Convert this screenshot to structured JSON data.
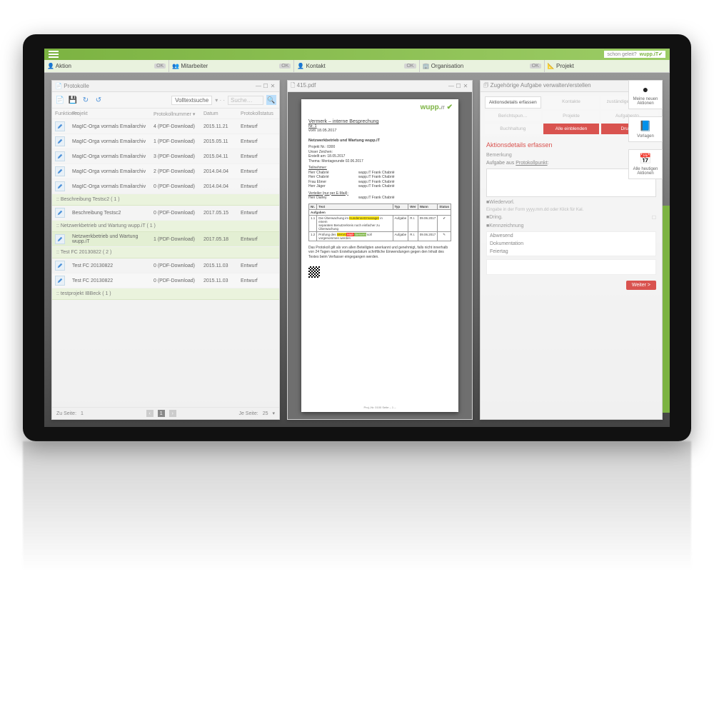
{
  "brand": {
    "tagline": "schon geleit?",
    "name": "wupp.",
    "suffix": "iT"
  },
  "tabs": [
    {
      "icon": "👤",
      "label": "Aktion",
      "ok": "OK"
    },
    {
      "icon": "👥",
      "label": "Mitarbeiter",
      "ok": "OK"
    },
    {
      "icon": "👤",
      "label": "Kontakt",
      "ok": "OK"
    },
    {
      "icon": "🏢",
      "label": "Organisation",
      "ok": "OK"
    },
    {
      "icon": "📐",
      "label": "Projekt",
      "ok": ""
    }
  ],
  "leftPanel": {
    "title": "Protokolle",
    "filterSelect": "Volltextsuche",
    "searchPlaceholder": "Suche…",
    "columns": {
      "c1": "Funktionen",
      "c2": "Projekt",
      "c3": "Protokollnummer",
      "c4": "Datum",
      "c5": "Protokollstatus"
    },
    "groups": [
      {
        "label": ":: MagIC-Orga vormals Emailarchiv",
        "rows": [
          {
            "project": "MagIC-Orga vormals Emailarchiv",
            "num": "4 (PDF-Download)",
            "date": "2015.11.21",
            "status": "Entwurf"
          },
          {
            "project": "MagIC-Orga vormals Emailarchiv",
            "num": "1 (PDF-Download)",
            "date": "2015.05.11",
            "status": "Entwurf"
          },
          {
            "project": "MagIC-Orga vormals Emailarchiv",
            "num": "3 (PDF-Download)",
            "date": "2015.04.11",
            "status": "Entwurf"
          },
          {
            "project": "MagIC-Orga vormals Emailarchiv",
            "num": "2 (PDF-Download)",
            "date": "2014.04.04",
            "status": "Entwurf"
          },
          {
            "project": "MagIC-Orga vormals Emailarchiv",
            "num": "0 (PDF-Download)",
            "date": "2014.04.04",
            "status": "Entwurf"
          }
        ]
      },
      {
        "label": ":: Beschreibung Testsc2 ( 1 )",
        "rows": [
          {
            "project": "Beschreibung Testsc2",
            "num": "0 (PDF-Download)",
            "date": "2017.05.15",
            "status": "Entwurf"
          }
        ]
      },
      {
        "label": ":: Netzwerkbetrieb und Wartung wupp.iT ( 1 )",
        "rows": [
          {
            "project": "Netzwerkbetrieb und Wartung wupp.iT",
            "num": "1 (PDF-Download)",
            "date": "2017.05.18",
            "status": "Entwurf",
            "selected": true
          }
        ]
      },
      {
        "label": ":: Test FC 20130822 ( 2 )",
        "rows": [
          {
            "project": "Test FC 20130822",
            "num": "0 (PDF-Download)",
            "date": "2015.11.03",
            "status": "Entwurf"
          },
          {
            "project": "Test FC 20130822",
            "num": "0 (PDF-Download)",
            "date": "2015.11.03",
            "status": "Entwurf"
          }
        ]
      },
      {
        "label": ":: testprojekt IBBeck ( 1 )",
        "rows": []
      }
    ],
    "pager": {
      "toPage": "Zu Seite:",
      "page": "1",
      "perPage": "Je Seite:",
      "size": "25"
    }
  },
  "pdf": {
    "tabTitle": "415.pdf",
    "heading": "Vermerk – interne Besprechung",
    "subhead": "Nr. 1",
    "dateline": "vom 18.05.2017",
    "section1": "Netzwerkbetrieb und Wartung wupp.iT",
    "meta": {
      "projektnr": "Projekt Nr.: 0300",
      "zeichen": "Unser Zeichen:",
      "erstellt": "Erstellt am: 18.05.2017",
      "thema": "Thema: Montagsrunde 02.06.2017"
    },
    "teilnehmerHdr": "Teilnehmer:",
    "teilnehmer": [
      {
        "l": "Herr Chabrié",
        "r": "wupp.iT Frank Chabrié"
      },
      {
        "l": "Herr Chabrié",
        "r": "wupp.iT Frank Chabrié"
      },
      {
        "l": "Frau Ebner",
        "r": "wupp.iT Frank Chabrié"
      },
      {
        "l": "Herr Jäger",
        "r": "wupp.iT Frank Chabrié"
      }
    ],
    "verteilerHdr": "Verteiler (nur per E-Mail):",
    "verteiler": {
      "l": "Herr Darley",
      "r": "wupp.iT Frank Chabrié"
    },
    "tableHdr": {
      "nr": "Nr.",
      "text": "Text",
      "typ": "Typ",
      "wer": "Wer",
      "wann": "Wann",
      "status": "Status"
    },
    "aufgaben": "Aufgaben",
    "rows": [
      {
        "nr": "1.1",
        "text_pre": "Die Überwachung im ",
        "hl1": "Kundennetzmanager",
        "text_mid": " in einem",
        "line2_pre": "separaten Benutzerkreis ",
        "line2_post": "noch einfacher zu Überwachung",
        "typ": "Aufgabe",
        "wer": "R.I.",
        "wann": "09.06.2017",
        "status": "✔"
      },
      {
        "nr": "1.2",
        "text_pre": "Prüfung des ",
        "hlY": "WHV0",
        "hlR": " Mail-",
        "hlG": " Servers",
        "text_post": " soll vorgenommen werden",
        "typ": "Aufgabe",
        "wer": "R.I.",
        "wann": "09.06.2017",
        "status": "✎"
      }
    ],
    "disclaimer": "Das Protokoll gilt als von allen Beteiligten anerkannt und genehmigt, falls nicht innerhalb von 24 Tagen nach Erstellungsdatum schriftliche Einwendungen gegen den Inhalt des Textes beim Verfasser eingegangen werden.",
    "footer": "Proj.-Nr. 0100\nSeite – 1 –"
  },
  "rightPanel": {
    "title": "Zugehörige Aufgabe verwalten/erstellen",
    "tabs": {
      "a1": "Aktionsdetails erfassen",
      "a2": "Kontakte",
      "a3": "zuständige Mitarbeiter",
      "b1": "Berichtspun…",
      "b2": "Projekte",
      "b3": "Aufgabesto…",
      "c1": "Buchhaltung",
      "c2": "Alle einblenden",
      "c3": "Drucken"
    },
    "heading": "Aktionsdetails erfassen",
    "bemerkungLbl": "Bemerkung",
    "aufgabeText": "Aufgabe aus ",
    "aufgabeLink": "Protokollpunkt",
    "wiedervorl": "Wiedervorl.",
    "wiedervorlHint": "Eingabe in der Form yyyy.mm.dd oder Klick für Kal.",
    "dring": "Dring.",
    "kennz": "Kennzeichnung",
    "tags": [
      "Abwesend",
      "Dokumentation",
      "Feiertag"
    ],
    "weiter": "Weiter >"
  },
  "rail": [
    {
      "icon": "●",
      "cls": "black",
      "label": "Meine neuen Aktionen"
    },
    {
      "icon": "📘",
      "cls": "blue",
      "label": "Vorlagen"
    },
    {
      "icon": "📅",
      "cls": "blue",
      "sub": "31",
      "label": "Alle heutigen Aktionen"
    }
  ]
}
